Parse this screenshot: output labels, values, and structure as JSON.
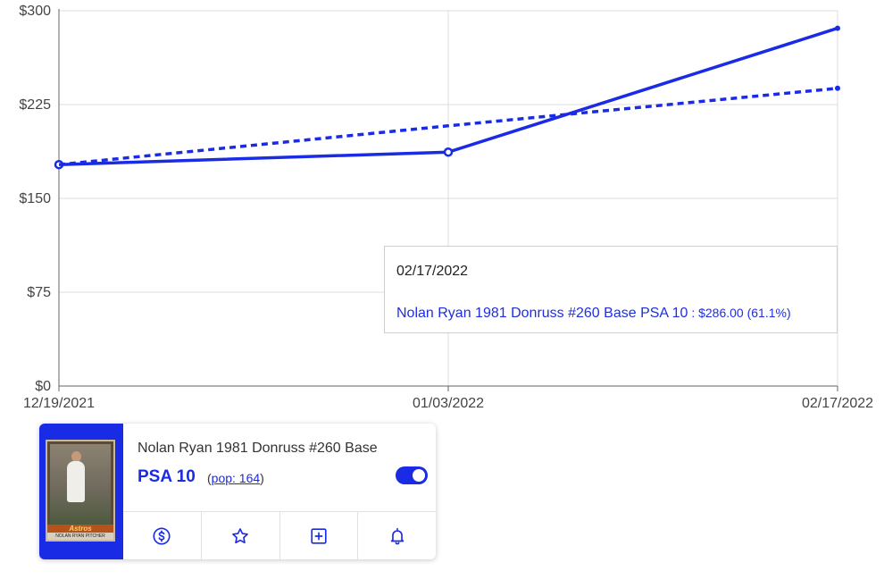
{
  "chart_data": {
    "type": "line",
    "x": [
      "12/19/2021",
      "01/03/2022",
      "02/17/2022"
    ],
    "ylim": [
      0,
      300
    ],
    "y_ticks": [
      "$0",
      "$75",
      "$150",
      "$225",
      "$300"
    ],
    "y_tick_values": [
      0,
      75,
      150,
      225,
      300
    ],
    "grid": true,
    "series": [
      {
        "name": "Nolan Ryan 1981 Donruss #260 Base PSA 10",
        "values": [
          177,
          187,
          286
        ],
        "style": "solid"
      },
      {
        "values": [
          177,
          208,
          238
        ],
        "style": "dashed"
      }
    ],
    "colors": {
      "line": "#1a2be6",
      "grid": "#dcdcdc"
    }
  },
  "tooltip": {
    "date": "02/17/2022",
    "series": "Nolan Ryan 1981 Donruss #260 Base PSA 10",
    "separator": " : ",
    "value": "$286.00 (61.1%)"
  },
  "card": {
    "title": "Nolan Ryan 1981 Donruss #260 Base",
    "grade": "PSA 10",
    "pop_prefix": "(",
    "pop_link": "pop: 164",
    "pop_suffix": ")",
    "image_banner": "Astros",
    "image_caption": "NOLAN RYAN PITCHER",
    "toggle_on": true,
    "actions": [
      {
        "icon": "dollar-icon"
      },
      {
        "icon": "star-icon"
      },
      {
        "icon": "plus-square-icon"
      },
      {
        "icon": "bell-icon"
      }
    ],
    "accent": "#1a2be6"
  }
}
